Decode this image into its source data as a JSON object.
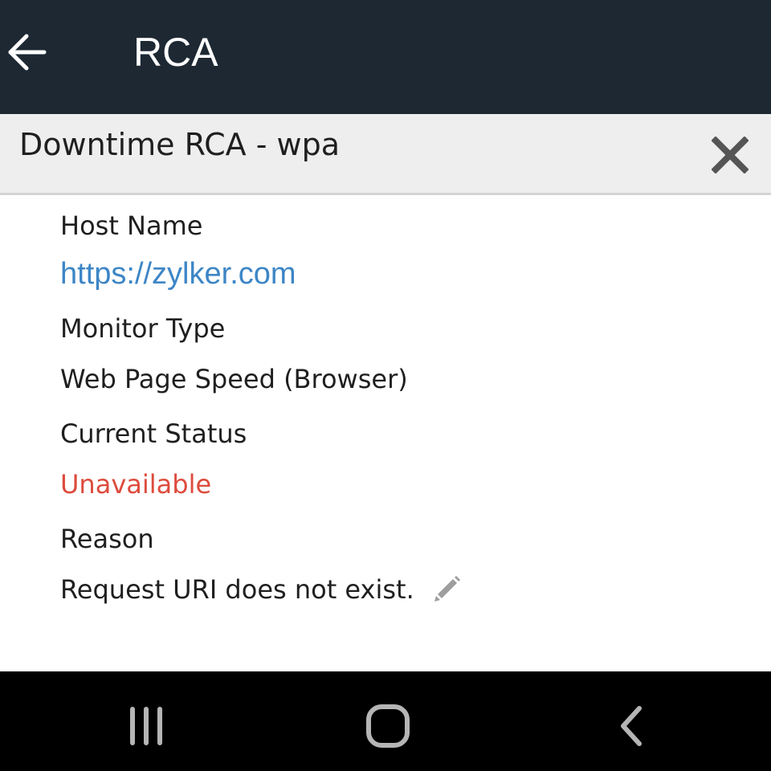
{
  "app_bar": {
    "title": "RCA",
    "back_icon": "arrow-left-icon"
  },
  "header": {
    "title": "Downtime RCA - wpa",
    "close_icon": "close-icon"
  },
  "details": {
    "host_name_label": "Host Name",
    "host_name_value": "https://zylker.com",
    "monitor_type_label": "Monitor Type",
    "monitor_type_value": "Web Page Speed (Browser)",
    "current_status_label": "Current Status",
    "current_status_value": "Unavailable",
    "reason_label": "Reason",
    "reason_value": "Request URI does not exist.",
    "edit_icon": "pencil-icon"
  },
  "colors": {
    "app_bar": "#1d2833",
    "link": "#3d86c6",
    "status_down": "#dd4b3d",
    "header_bg": "#eeeeee"
  },
  "system_nav": {
    "recents_icon": "recent-apps-icon",
    "home_icon": "home-icon",
    "back_icon": "system-back-icon"
  }
}
